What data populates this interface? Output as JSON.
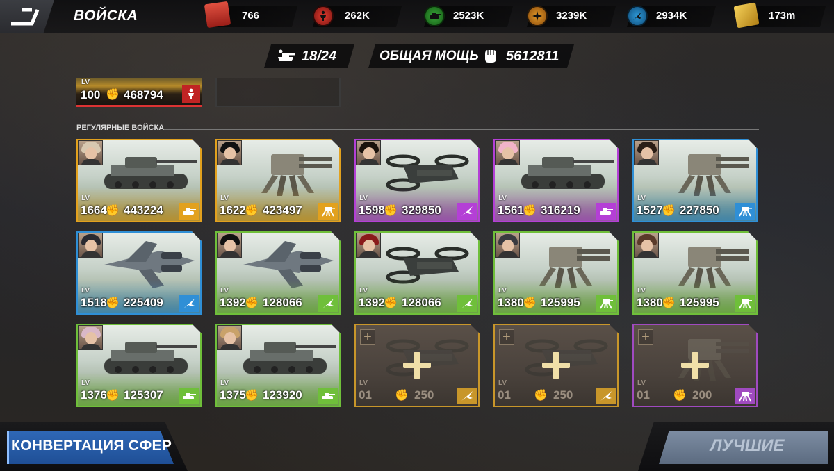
{
  "header": {
    "title": "ВОЙСКА",
    "resources": [
      {
        "name": "battle-cards",
        "icon": "red-box-icon",
        "value": "766",
        "color": "#c9302c"
      },
      {
        "name": "infantry",
        "icon": "soldier-icon",
        "value": "262K",
        "color": "#c9302c"
      },
      {
        "name": "tanks",
        "icon": "tank-icon",
        "value": "2523K",
        "color": "#2e8b2e"
      },
      {
        "name": "aircraft",
        "icon": "plane-icon",
        "value": "3239K",
        "color": "#c97a1a"
      },
      {
        "name": "mech",
        "icon": "jet-icon",
        "value": "2934K",
        "color": "#1e7fb8"
      },
      {
        "name": "gold",
        "icon": "gold-bars-icon",
        "value": "173m",
        "color": "#d8a52a"
      }
    ]
  },
  "summary": {
    "troop_count": "18/24",
    "power_label": "ОБЩАЯ МОЩЬ",
    "power_value": "5612811"
  },
  "hero_card": {
    "level": "100",
    "power": "468794",
    "lv_label": "LV"
  },
  "section_label": "РЕГУЛЯРНЫЕ ВОЙСКА",
  "cards": [
    {
      "lv_label": "LV",
      "level": "1664",
      "power": "443224",
      "rarity": "#e2a11e",
      "badge": "tank-icon",
      "art": "tank",
      "hair": "#d8c8b0"
    },
    {
      "lv_label": "LV",
      "level": "1622",
      "power": "423497",
      "rarity": "#e2a11e",
      "badge": "mech-icon",
      "art": "mech",
      "hair": "#111"
    },
    {
      "lv_label": "LV",
      "level": "1598",
      "power": "329850",
      "rarity": "#b43fd6",
      "badge": "jet-icon",
      "art": "drone",
      "hair": "#1a120c"
    },
    {
      "lv_label": "LV",
      "level": "1561",
      "power": "316219",
      "rarity": "#b43fd6",
      "badge": "tank-icon",
      "art": "tank",
      "hair": "#f1b3c8"
    },
    {
      "lv_label": "LV",
      "level": "1527",
      "power": "227850",
      "rarity": "#2f8fd6",
      "badge": "mech-icon",
      "art": "mech",
      "hair": "#2a1e16"
    },
    {
      "lv_label": "LV",
      "level": "1518",
      "power": "225409",
      "rarity": "#2f8fd6",
      "badge": "jet-icon",
      "art": "gunship",
      "hair": "#2a2a30"
    },
    {
      "lv_label": "LV",
      "level": "1392",
      "power": "128066",
      "rarity": "#6fbf3a",
      "badge": "jet-icon",
      "art": "gunship",
      "hair": "#111"
    },
    {
      "lv_label": "LV",
      "level": "1392",
      "power": "128066",
      "rarity": "#6fbf3a",
      "badge": "jet-icon",
      "art": "drone",
      "hair": "#8a1a1a"
    },
    {
      "lv_label": "LV",
      "level": "1380",
      "power": "125995",
      "rarity": "#6fbf3a",
      "badge": "mech-icon",
      "art": "mech",
      "hair": "#3a3a40"
    },
    {
      "lv_label": "LV",
      "level": "1380",
      "power": "125995",
      "rarity": "#6fbf3a",
      "badge": "mech-icon",
      "art": "mech",
      "hair": "#5a3a2a"
    },
    {
      "lv_label": "LV",
      "level": "1376",
      "power": "125307",
      "rarity": "#6fbf3a",
      "badge": "tank-icon",
      "art": "tank",
      "hair": "#d9b8c8"
    },
    {
      "lv_label": "LV",
      "level": "1375",
      "power": "123920",
      "rarity": "#6fbf3a",
      "badge": "tank-icon",
      "art": "tank",
      "hair": "#c9a26a"
    },
    {
      "lv_label": "LV",
      "level": "01",
      "power": "250",
      "rarity": "#c8962a",
      "badge": "jet-icon",
      "art": "drone",
      "locked": true
    },
    {
      "lv_label": "LV",
      "level": "01",
      "power": "250",
      "rarity": "#c8962a",
      "badge": "jet-icon",
      "art": "drone",
      "locked": true
    },
    {
      "lv_label": "LV",
      "level": "01",
      "power": "200",
      "rarity": "#a04ac0",
      "badge": "mech-icon",
      "art": "mech",
      "locked": true
    }
  ],
  "buttons": {
    "convert": "КОНВЕРТАЦИЯ СФЕР",
    "best": "ЛУЧШИЕ"
  }
}
